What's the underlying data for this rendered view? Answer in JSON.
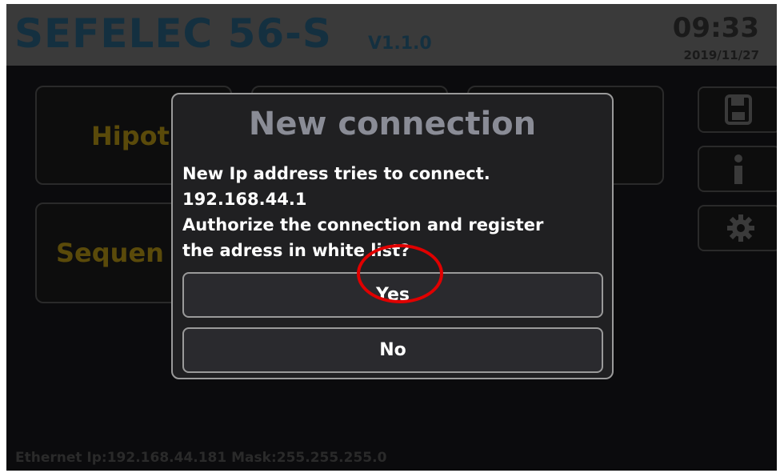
{
  "header": {
    "title": "SEFELEC 56-S",
    "version": "V1.1.0",
    "time": "09:33",
    "date": "2019/11/27"
  },
  "tiles": {
    "hipot_label": "Hipot",
    "sequence_label": "Sequen"
  },
  "side_buttons": [
    {
      "icon": "save-icon"
    },
    {
      "icon": "info-icon"
    },
    {
      "icon": "gear-icon"
    }
  ],
  "footer": {
    "status": "Ethernet Ip:192.168.44.181 Mask:255.255.255.0"
  },
  "dialog": {
    "title": "New connection",
    "line1": "New Ip address tries to connect.",
    "line2": "192.168.44.1",
    "line3": "Authorize the connection and register",
    "line4": "the adress in white list?",
    "yes_label": "Yes",
    "no_label": "No"
  },
  "colors": {
    "annotation": "#e00000",
    "dialog_bg": "#202022"
  }
}
